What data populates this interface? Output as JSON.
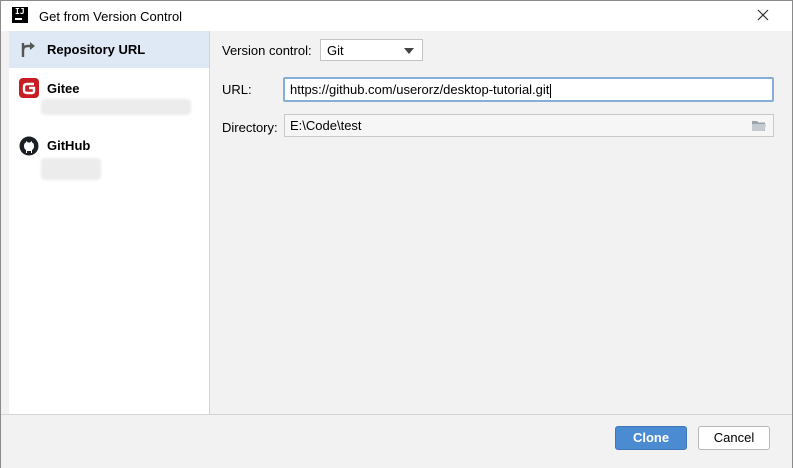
{
  "window": {
    "title": "Get from Version Control",
    "app_icon_text": "IJ"
  },
  "sidebar": {
    "items": [
      {
        "label": "Repository URL",
        "icon": "vcs-branch-icon",
        "selected": true
      },
      {
        "label": "Gitee",
        "icon": "gitee-logo-icon",
        "selected": false
      },
      {
        "label": "GitHub",
        "icon": "github-logo-icon",
        "selected": false
      }
    ]
  },
  "form": {
    "version_control_label": "Version control:",
    "version_control_value": "Git",
    "url_label": "URL:",
    "url_value": "https://github.com/userorz/desktop-tutorial.git",
    "directory_label": "Directory:",
    "directory_value": "E:\\Code\\test"
  },
  "footer": {
    "clone_label": "Clone",
    "cancel_label": "Cancel"
  },
  "colors": {
    "accent": "#4a8bd2",
    "selection": "#dfe9f5",
    "gitee_red": "#c71d23"
  }
}
